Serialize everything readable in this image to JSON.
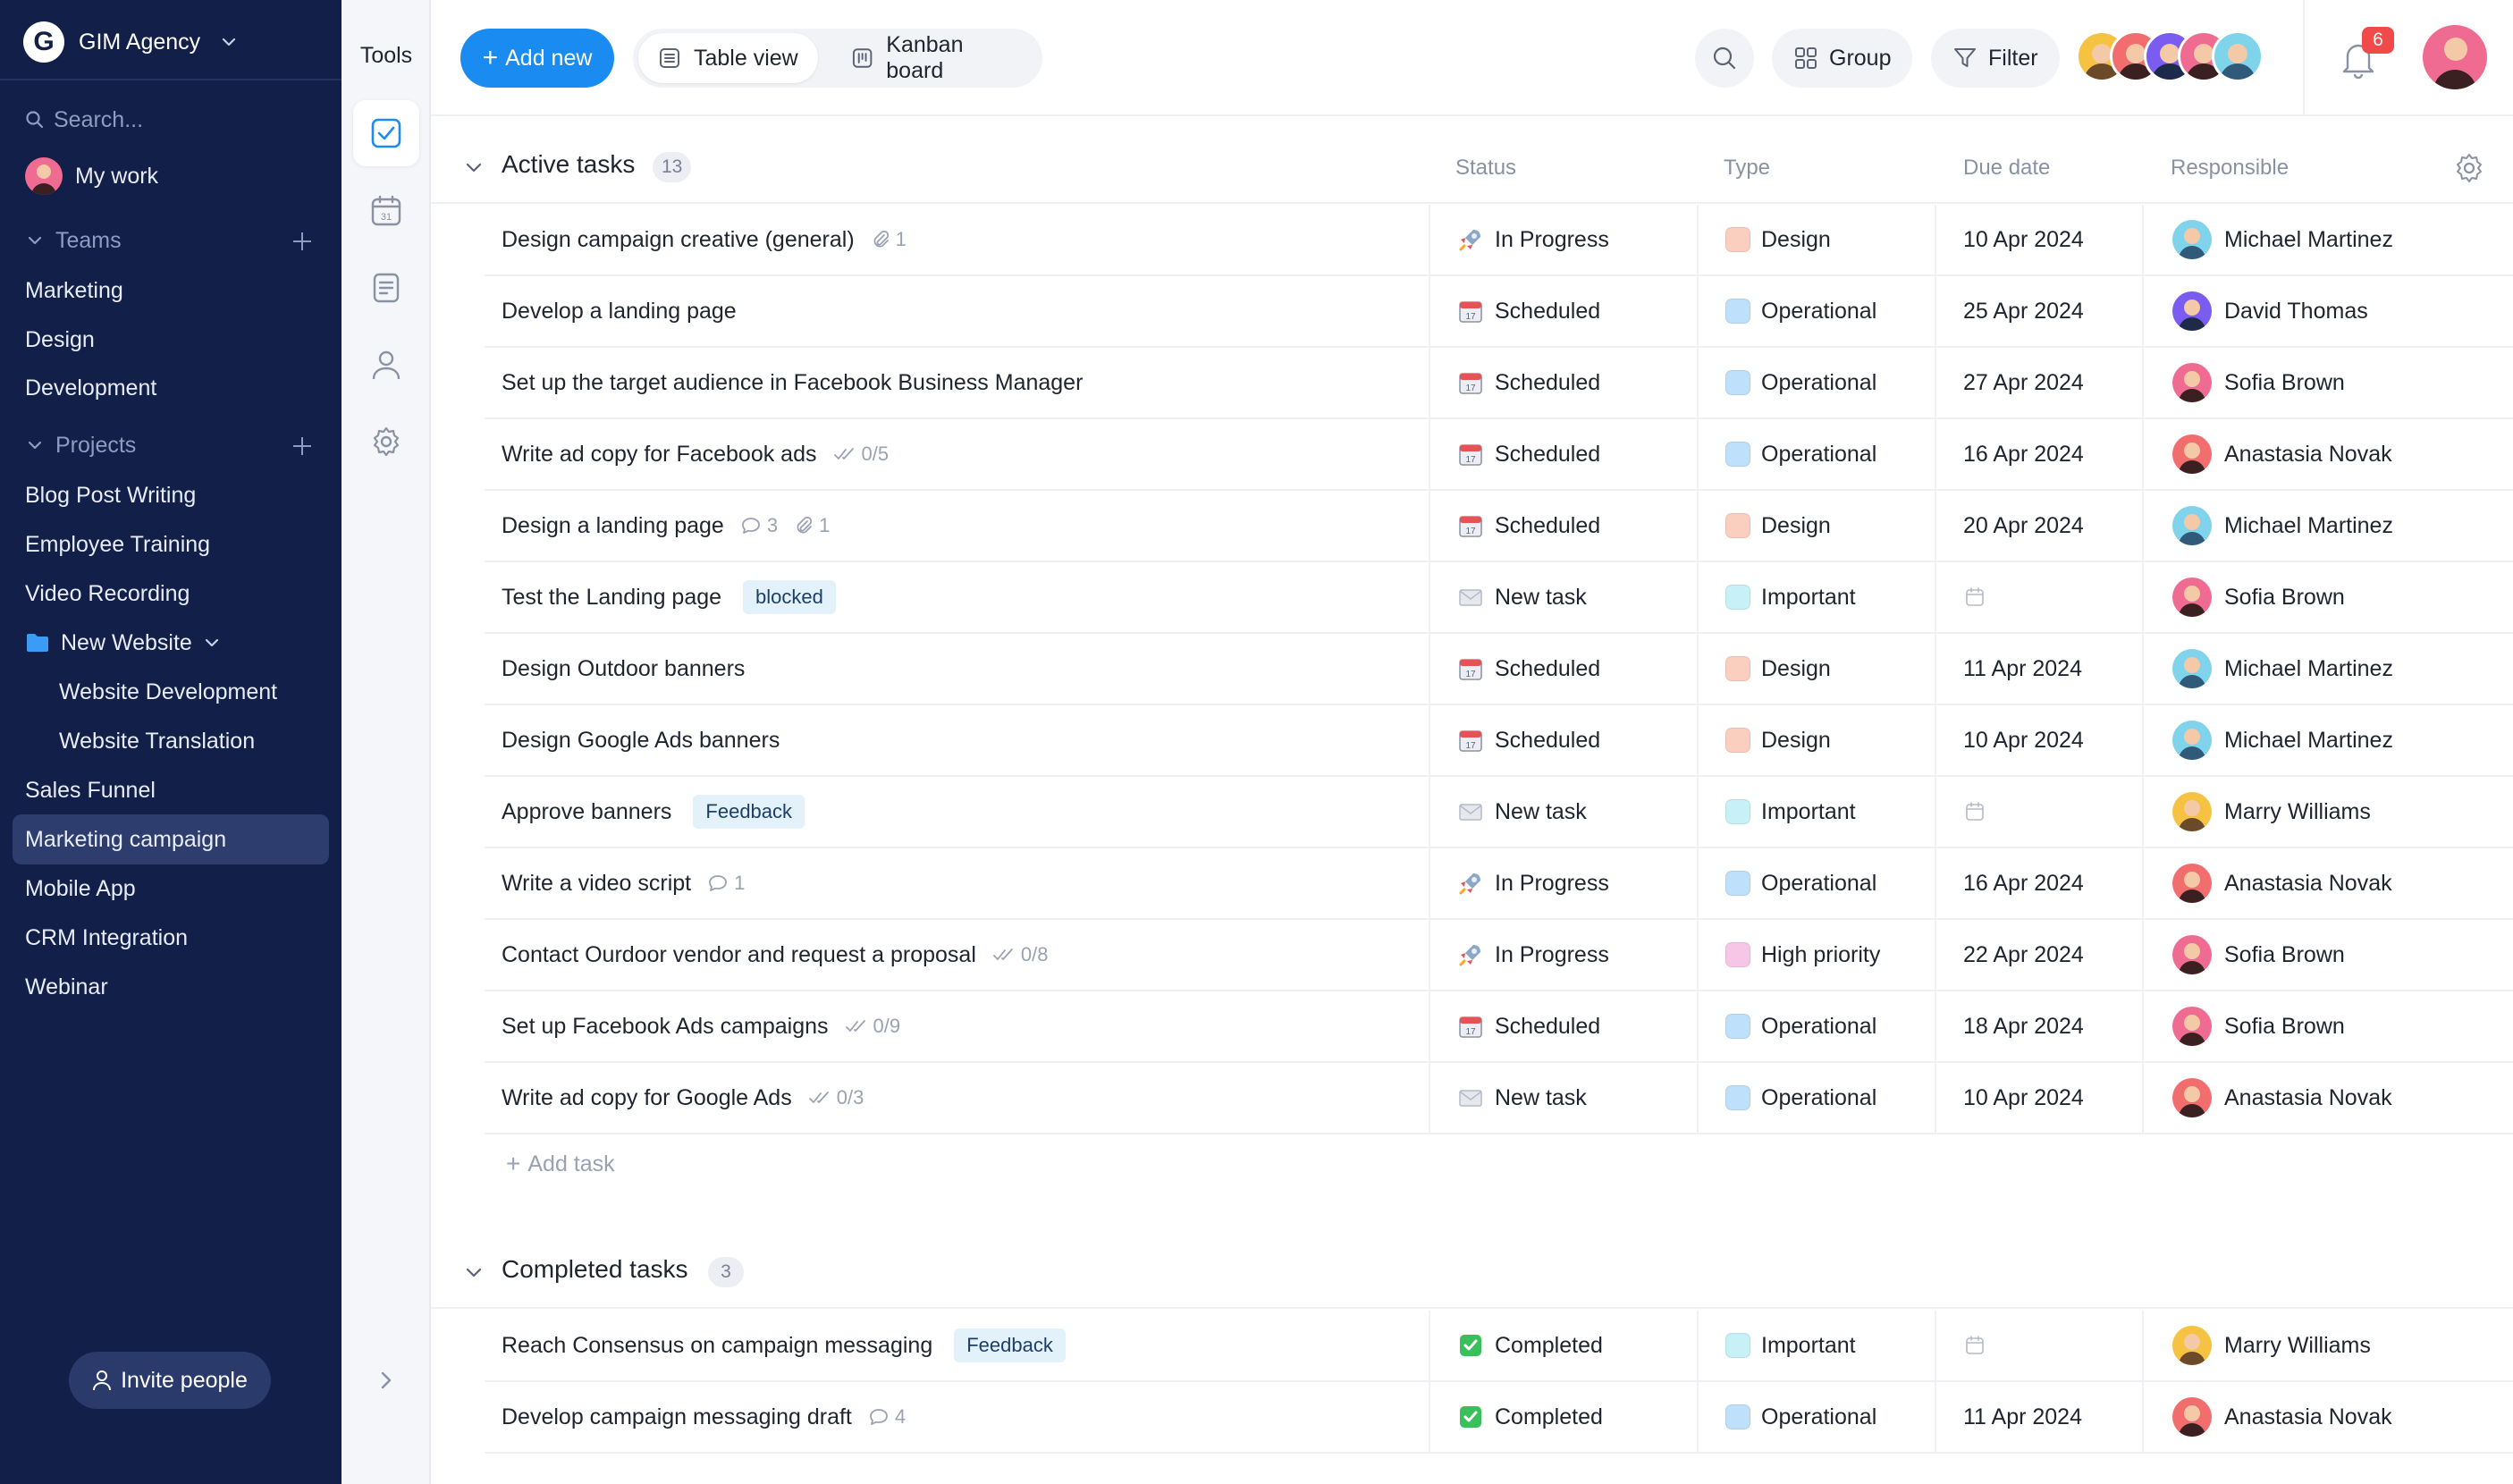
{
  "workspace": {
    "name": "GIM Agency",
    "logo_letter": "G"
  },
  "sidebar": {
    "search_placeholder": "Search...",
    "my_work": "My work",
    "teams_label": "Teams",
    "teams": [
      "Marketing",
      "Design",
      "Development"
    ],
    "projects_label": "Projects",
    "projects": [
      {
        "label": "Blog Post Writing"
      },
      {
        "label": "Employee Training"
      },
      {
        "label": "Video Recording"
      },
      {
        "label": "New Website"
      },
      {
        "label": "Website Development"
      },
      {
        "label": "Website Translation"
      },
      {
        "label": "Sales Funnel"
      },
      {
        "label": "Marketing campaign"
      },
      {
        "label": "Mobile App"
      },
      {
        "label": "CRM Integration"
      },
      {
        "label": "Webinar"
      }
    ],
    "active_project": "Marketing campaign",
    "invite_label": "Invite people"
  },
  "tools": {
    "title": "Tools"
  },
  "toolbar": {
    "add_new": "Add new",
    "table_view": "Table view",
    "kanban_board": "Kanban board",
    "group": "Group",
    "filter": "Filter",
    "notifications_count": "6"
  },
  "colors": {
    "sidebar_bg": "#121f48",
    "accent": "#1a8cf1",
    "type_design": "#fbcfbf",
    "type_operational": "#bfe0fb",
    "type_important": "#c7f0f7",
    "type_high_priority": "#f7c6e6"
  },
  "active": {
    "title": "Active tasks",
    "count": "13",
    "columns": {
      "status": "Status",
      "type": "Type",
      "due": "Due date",
      "responsible": "Responsible"
    },
    "add_task": "Add task",
    "rows": [
      {
        "name": "Design campaign creative (general)",
        "meta": [
          {
            "icon": "paperclip-icon",
            "text": "1"
          }
        ],
        "tag": "",
        "status": "In Progress",
        "status_icon": "rocket",
        "type": "Design",
        "due": "10 Apr 2024",
        "responsible": "Michael Martinez"
      },
      {
        "name": "Develop a landing page",
        "meta": [],
        "tag": "",
        "status": "Scheduled",
        "status_icon": "calendar",
        "type": "Operational",
        "due": "25 Apr 2024",
        "responsible": "David Thomas"
      },
      {
        "name": "Set up the target audience in Facebook Business Manager",
        "meta": [],
        "tag": "",
        "status": "Scheduled",
        "status_icon": "calendar",
        "type": "Operational",
        "due": "27 Apr 2024",
        "responsible": "Sofia Brown"
      },
      {
        "name": "Write ad copy for Facebook ads",
        "meta": [
          {
            "icon": "checklist-icon",
            "text": "0/5"
          }
        ],
        "tag": "",
        "status": "Scheduled",
        "status_icon": "calendar",
        "type": "Operational",
        "due": "16 Apr 2024",
        "responsible": "Anastasia Novak"
      },
      {
        "name": "Design a landing page",
        "meta": [
          {
            "icon": "comment-icon",
            "text": "3"
          },
          {
            "icon": "paperclip-icon",
            "text": "1"
          }
        ],
        "tag": "",
        "status": "Scheduled",
        "status_icon": "calendar",
        "type": "Design",
        "due": "20 Apr 2024",
        "responsible": "Michael Martinez"
      },
      {
        "name": "Test the Landing page",
        "meta": [],
        "tag": "blocked",
        "status": "New task",
        "status_icon": "envelope",
        "type": "Important",
        "due": "",
        "responsible": "Sofia Brown"
      },
      {
        "name": "Design Outdoor banners",
        "meta": [],
        "tag": "",
        "status": "Scheduled",
        "status_icon": "calendar",
        "type": "Design",
        "due": "11 Apr 2024",
        "responsible": "Michael Martinez"
      },
      {
        "name": "Design Google Ads banners",
        "meta": [],
        "tag": "",
        "status": "Scheduled",
        "status_icon": "calendar",
        "type": "Design",
        "due": "10 Apr 2024",
        "responsible": "Michael Martinez"
      },
      {
        "name": "Approve banners",
        "meta": [],
        "tag": "Feedback",
        "status": "New task",
        "status_icon": "envelope",
        "type": "Important",
        "due": "",
        "responsible": "Marry Williams"
      },
      {
        "name": "Write a video script",
        "meta": [
          {
            "icon": "comment-icon",
            "text": "1"
          }
        ],
        "tag": "",
        "status": "In Progress",
        "status_icon": "rocket",
        "type": "Operational",
        "due": "16 Apr 2024",
        "responsible": "Anastasia Novak"
      },
      {
        "name": "Contact Ourdoor vendor and request a proposal",
        "meta": [
          {
            "icon": "checklist-icon",
            "text": "0/8"
          }
        ],
        "tag": "",
        "status": "In Progress",
        "status_icon": "rocket",
        "type": "High priority",
        "due": "22 Apr 2024",
        "responsible": "Sofia Brown"
      },
      {
        "name": "Set up Facebook Ads campaigns",
        "meta": [
          {
            "icon": "checklist-icon",
            "text": "0/9"
          }
        ],
        "tag": "",
        "status": "Scheduled",
        "status_icon": "calendar",
        "type": "Operational",
        "due": "18 Apr 2024",
        "responsible": "Sofia Brown"
      },
      {
        "name": "Write ad copy for Google Ads",
        "meta": [
          {
            "icon": "checklist-icon",
            "text": "0/3"
          }
        ],
        "tag": "",
        "status": "New task",
        "status_icon": "envelope",
        "type": "Operational",
        "due": "10 Apr 2024",
        "responsible": "Anastasia Novak"
      }
    ]
  },
  "completed": {
    "title": "Completed tasks",
    "count": "3",
    "rows": [
      {
        "name": "Reach Consensus on campaign messaging",
        "meta": [],
        "tag": "Feedback",
        "status": "Completed",
        "status_icon": "check",
        "type": "Important",
        "due": "",
        "responsible": "Marry Williams"
      },
      {
        "name": "Develop campaign messaging draft",
        "meta": [
          {
            "icon": "comment-icon",
            "text": "4"
          }
        ],
        "tag": "",
        "status": "Completed",
        "status_icon": "check",
        "type": "Operational",
        "due": "11 Apr 2024",
        "responsible": "Anastasia Novak"
      }
    ]
  }
}
